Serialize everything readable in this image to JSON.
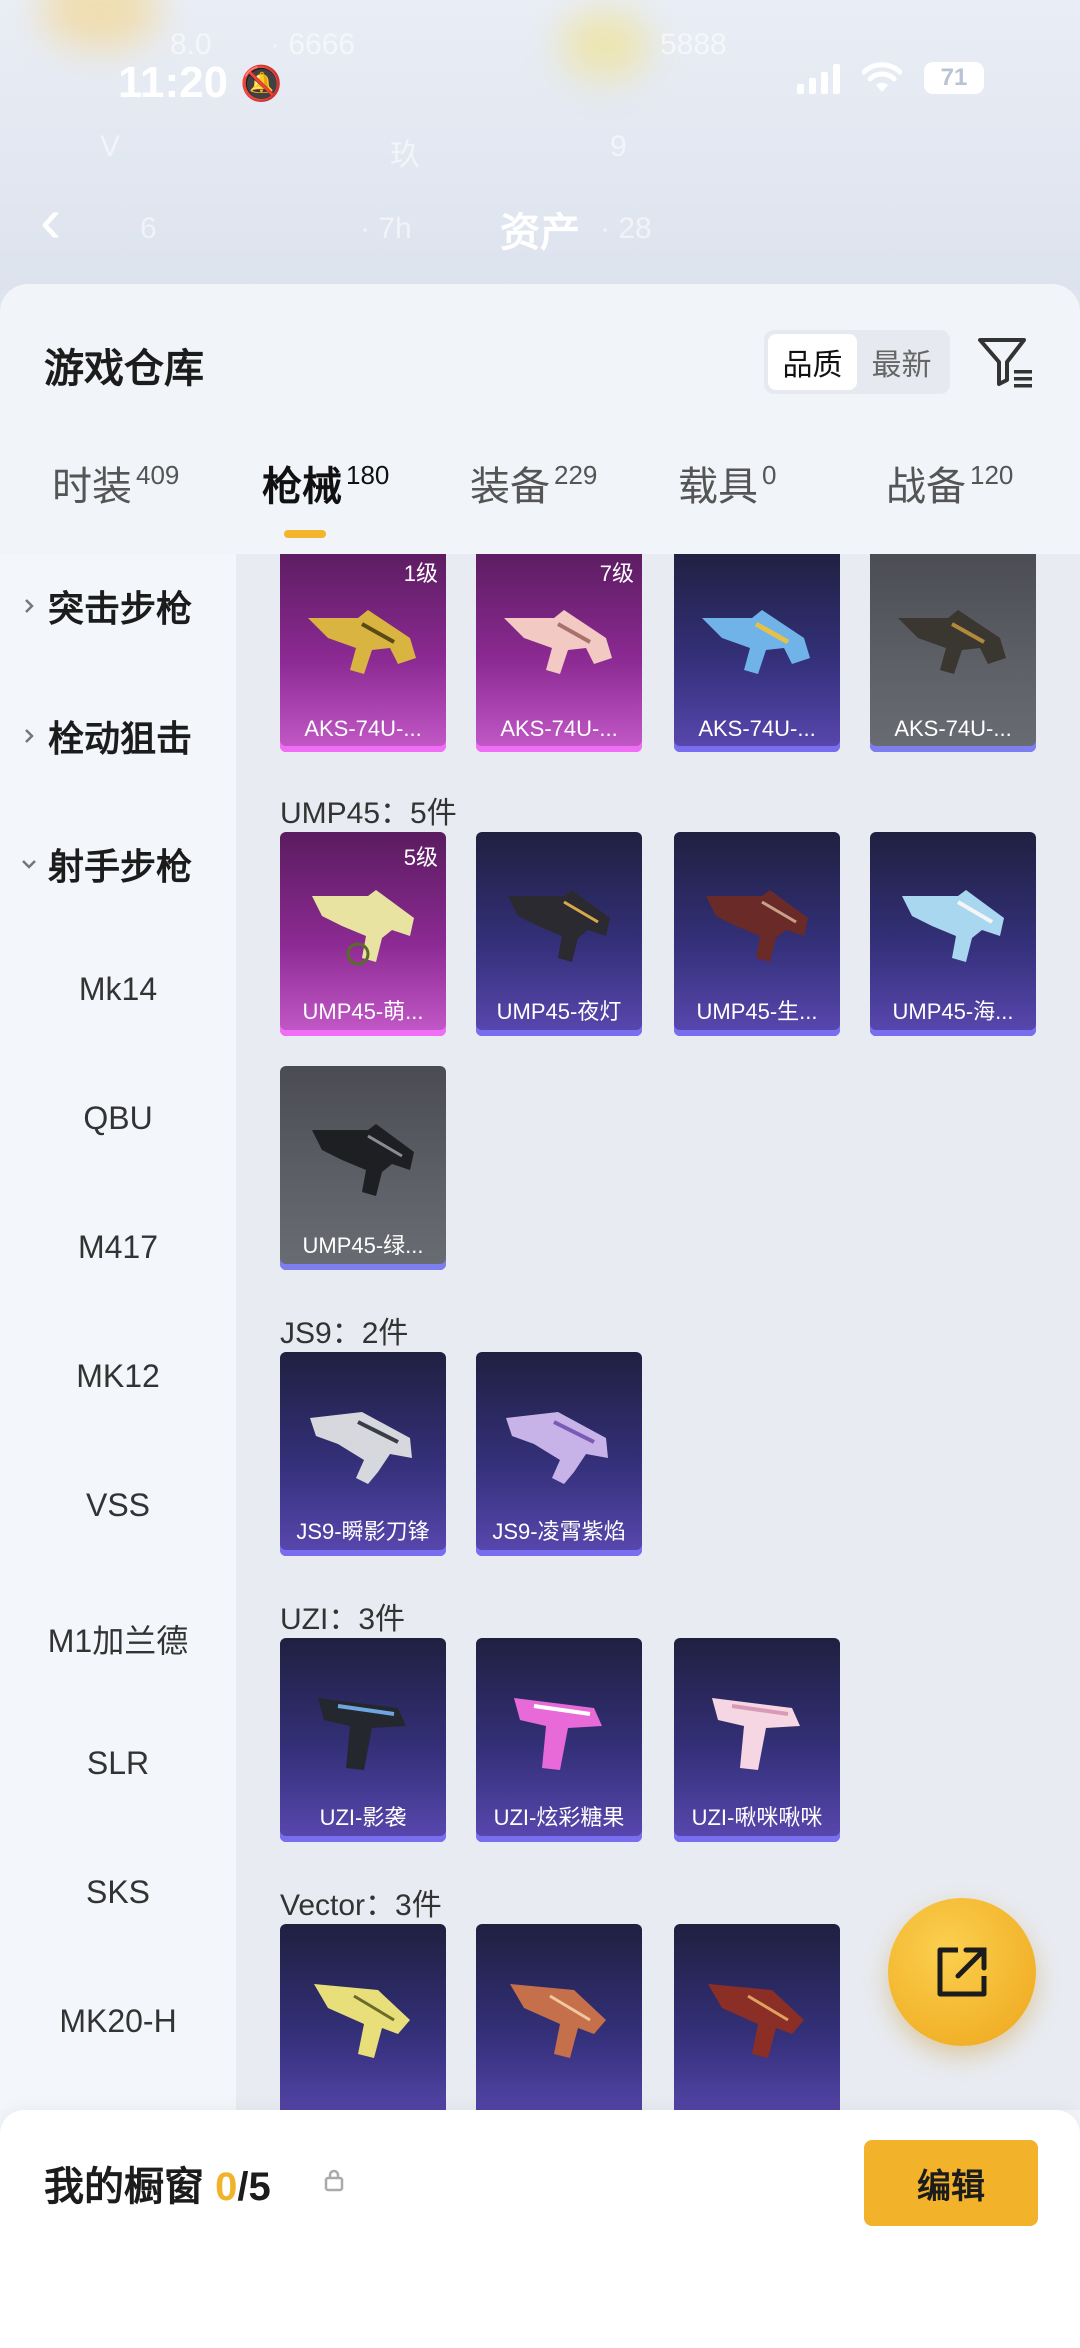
{
  "status_bar": {
    "time": "11:20",
    "battery": "71"
  },
  "background": {
    "title": "资产"
  },
  "sheet": {
    "title": "游戏仓库",
    "sort": {
      "options": [
        "品质",
        "最新"
      ],
      "active": "品质"
    }
  },
  "tabs": [
    {
      "label": "时装",
      "count": "409"
    },
    {
      "label": "枪械",
      "count": "180"
    },
    {
      "label": "装备",
      "count": "229"
    },
    {
      "label": "载具",
      "count": "0"
    },
    {
      "label": "战备",
      "count": "120"
    }
  ],
  "sidenav": {
    "categories": [
      {
        "label": "突击步枪",
        "state": "collapsed"
      },
      {
        "label": "栓动狙击",
        "state": "collapsed"
      },
      {
        "label": "射手步枪",
        "state": "expanded"
      }
    ],
    "subitems": [
      "Mk14",
      "QBU",
      "M417",
      "MK12",
      "VSS",
      "M1加兰德",
      "SLR",
      "SKS",
      "MK20-H"
    ]
  },
  "groups": {
    "aks": {
      "items": [
        {
          "name": "AKS-74U-...",
          "level": "1级",
          "rarity": "purple"
        },
        {
          "name": "AKS-74U-...",
          "level": "7级",
          "rarity": "purple"
        },
        {
          "name": "AKS-74U-...",
          "level": "",
          "rarity": "blue"
        },
        {
          "name": "AKS-74U-...",
          "level": "",
          "rarity": "gray"
        }
      ]
    },
    "ump": {
      "label": "UMP45：5件",
      "items": [
        {
          "name": "UMP45-萌...",
          "level": "5级",
          "rarity": "purple"
        },
        {
          "name": "UMP45-夜灯",
          "level": "",
          "rarity": "blue"
        },
        {
          "name": "UMP45-生...",
          "level": "",
          "rarity": "blue"
        },
        {
          "name": "UMP45-海...",
          "level": "",
          "rarity": "blue"
        },
        {
          "name": "UMP45-绿...",
          "level": "",
          "rarity": "gray"
        }
      ]
    },
    "js9": {
      "label": "JS9：2件",
      "items": [
        {
          "name": "JS9-瞬影刀锋",
          "rarity": "blue"
        },
        {
          "name": "JS9-凌霄紫焰",
          "rarity": "blue"
        }
      ]
    },
    "uzi": {
      "label": "UZI：3件",
      "items": [
        {
          "name": "UZI-影袭",
          "rarity": "blue"
        },
        {
          "name": "UZI-炫彩糖果",
          "rarity": "blue"
        },
        {
          "name": "UZI-啾咪啾咪",
          "rarity": "blue"
        }
      ]
    },
    "vector": {
      "label": "Vector：3件"
    }
  },
  "showcase": {
    "title": "我的橱窗",
    "used": "0",
    "total": "/5",
    "edit_label": "编辑"
  },
  "colors": {
    "accent": "#f2b22a",
    "purple_rarity": "#c45ac9",
    "blue_rarity": "#5a48b0",
    "gray_rarity": "#6a6c73"
  }
}
